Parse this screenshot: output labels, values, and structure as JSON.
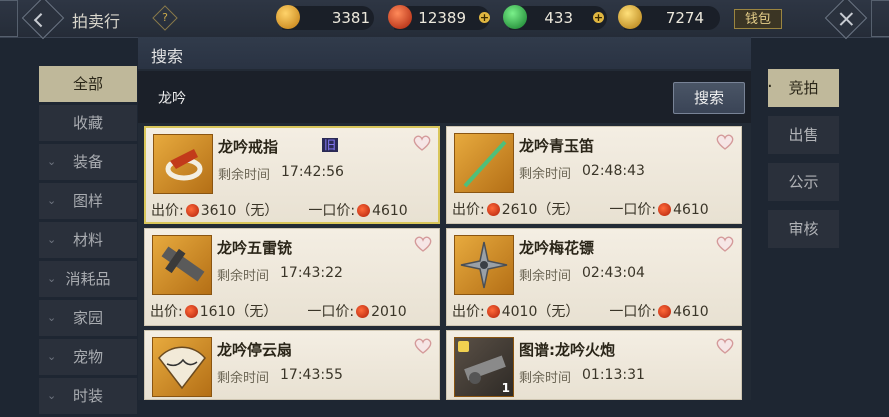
{
  "header": {
    "title": "拍卖行",
    "help_label": "?",
    "currencies": [
      {
        "icon": "gold-coin-icon",
        "value": "3381"
      },
      {
        "icon": "red-coin-icon",
        "value": "12389"
      },
      {
        "icon": "jade-icon",
        "value": "433"
      },
      {
        "icon": "gold-ingot-icon",
        "value": "7274"
      }
    ],
    "wallet_label": "钱包"
  },
  "sidebar": {
    "items": [
      {
        "label": "全部",
        "active": true,
        "expandable": false
      },
      {
        "label": "收藏",
        "active": false,
        "expandable": false
      },
      {
        "label": "装备",
        "active": false,
        "expandable": true
      },
      {
        "label": "图样",
        "active": false,
        "expandable": true
      },
      {
        "label": "材料",
        "active": false,
        "expandable": true
      },
      {
        "label": "消耗品",
        "active": false,
        "expandable": true
      },
      {
        "label": "家园",
        "active": false,
        "expandable": true
      },
      {
        "label": "宠物",
        "active": false,
        "expandable": true
      },
      {
        "label": "时装",
        "active": false,
        "expandable": true
      }
    ]
  },
  "panel": {
    "title": "搜索",
    "search_value": "龙吟",
    "search_button": "搜索"
  },
  "labels": {
    "time_left": "剩余时间",
    "bid": "出价:",
    "buyout": "一口价:"
  },
  "items": [
    {
      "name": "龙吟戒指",
      "tag": "旧",
      "time": "17:42:56",
      "bid": "3610（无）",
      "buyout": "4610",
      "selected": true,
      "count": ""
    },
    {
      "name": "龙吟青玉笛",
      "tag": "",
      "time": "02:48:43",
      "bid": "2610（无）",
      "buyout": "4610",
      "selected": false,
      "count": ""
    },
    {
      "name": "龙吟五雷铳",
      "tag": "",
      "time": "17:43:22",
      "bid": "1610（无）",
      "buyout": "2010",
      "selected": false,
      "count": ""
    },
    {
      "name": "龙吟梅花镖",
      "tag": "",
      "time": "02:43:04",
      "bid": "4010（无）",
      "buyout": "4610",
      "selected": false,
      "count": ""
    },
    {
      "name": "龙吟停云扇",
      "tag": "",
      "time": "17:43:55",
      "bid": "",
      "buyout": "",
      "selected": false,
      "count": ""
    },
    {
      "name": "图谱:龙吟火炮",
      "tag": "",
      "time": "01:13:31",
      "bid": "",
      "buyout": "",
      "selected": false,
      "count": "1"
    }
  ],
  "right_tabs": [
    {
      "label": "竞拍",
      "active": true
    },
    {
      "label": "出售",
      "active": false
    },
    {
      "label": "公示",
      "active": false
    },
    {
      "label": "审核",
      "active": false
    }
  ],
  "colors": {
    "background": "#1e2632",
    "card": "#f4eee3",
    "active_tab": "#bfb89a",
    "selected_border": "#d9c65a"
  }
}
